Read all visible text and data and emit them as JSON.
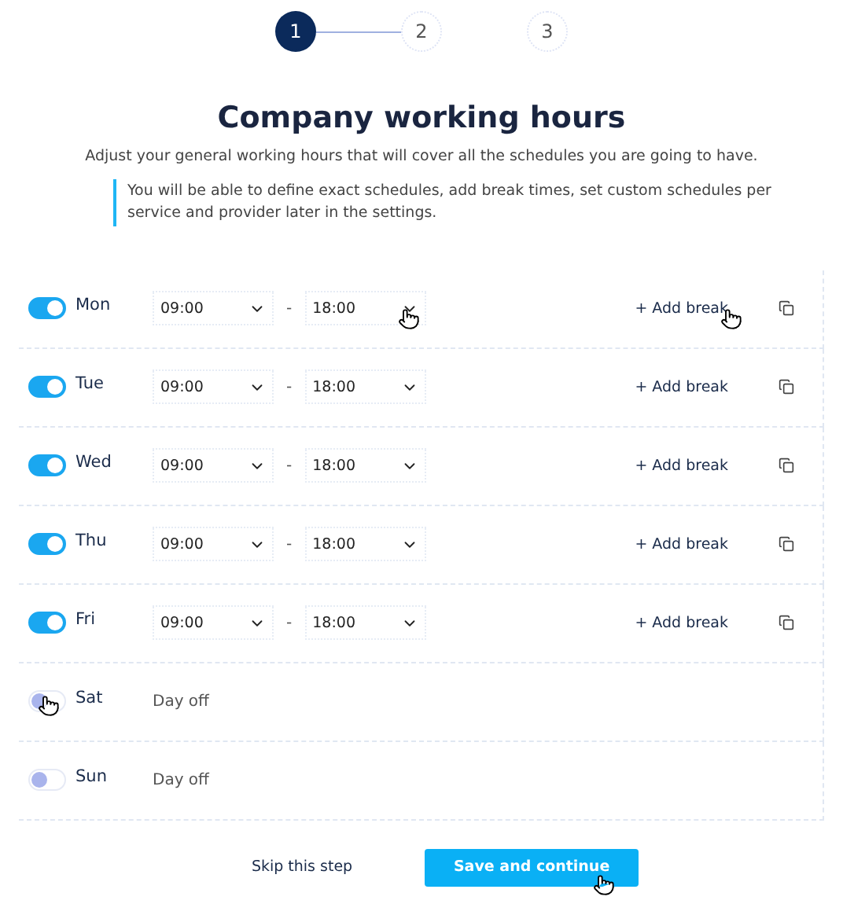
{
  "steps": [
    {
      "label": "1",
      "selected": true
    },
    {
      "label": "2",
      "selected": false
    },
    {
      "label": "3",
      "selected": false
    }
  ],
  "title": "Company working hours",
  "subtitle": "Adjust your general working hours that will cover all the schedules you are going to have.",
  "note": "You will be able to define exact schedules, add break times, set custom schedules per service and provider later in the settings.",
  "days": [
    {
      "day": "Mon",
      "on": true,
      "start": "09:00",
      "end": "18:00",
      "separator": "-",
      "add_break": "+ Add break"
    },
    {
      "day": "Tue",
      "on": true,
      "start": "09:00",
      "end": "18:00",
      "separator": "-",
      "add_break": "+ Add break"
    },
    {
      "day": "Wed",
      "on": true,
      "start": "09:00",
      "end": "18:00",
      "separator": "-",
      "add_break": "+ Add break"
    },
    {
      "day": "Thu",
      "on": true,
      "start": "09:00",
      "end": "18:00",
      "separator": "-",
      "add_break": "+ Add break"
    },
    {
      "day": "Fri",
      "on": true,
      "start": "09:00",
      "end": "18:00",
      "separator": "-",
      "add_break": "+ Add break"
    },
    {
      "day": "Sat",
      "on": false,
      "off_label": "Day off"
    },
    {
      "day": "Sun",
      "on": false,
      "off_label": "Day off"
    }
  ],
  "skip_button": "Skip this step",
  "save_button": "Save and continue"
}
